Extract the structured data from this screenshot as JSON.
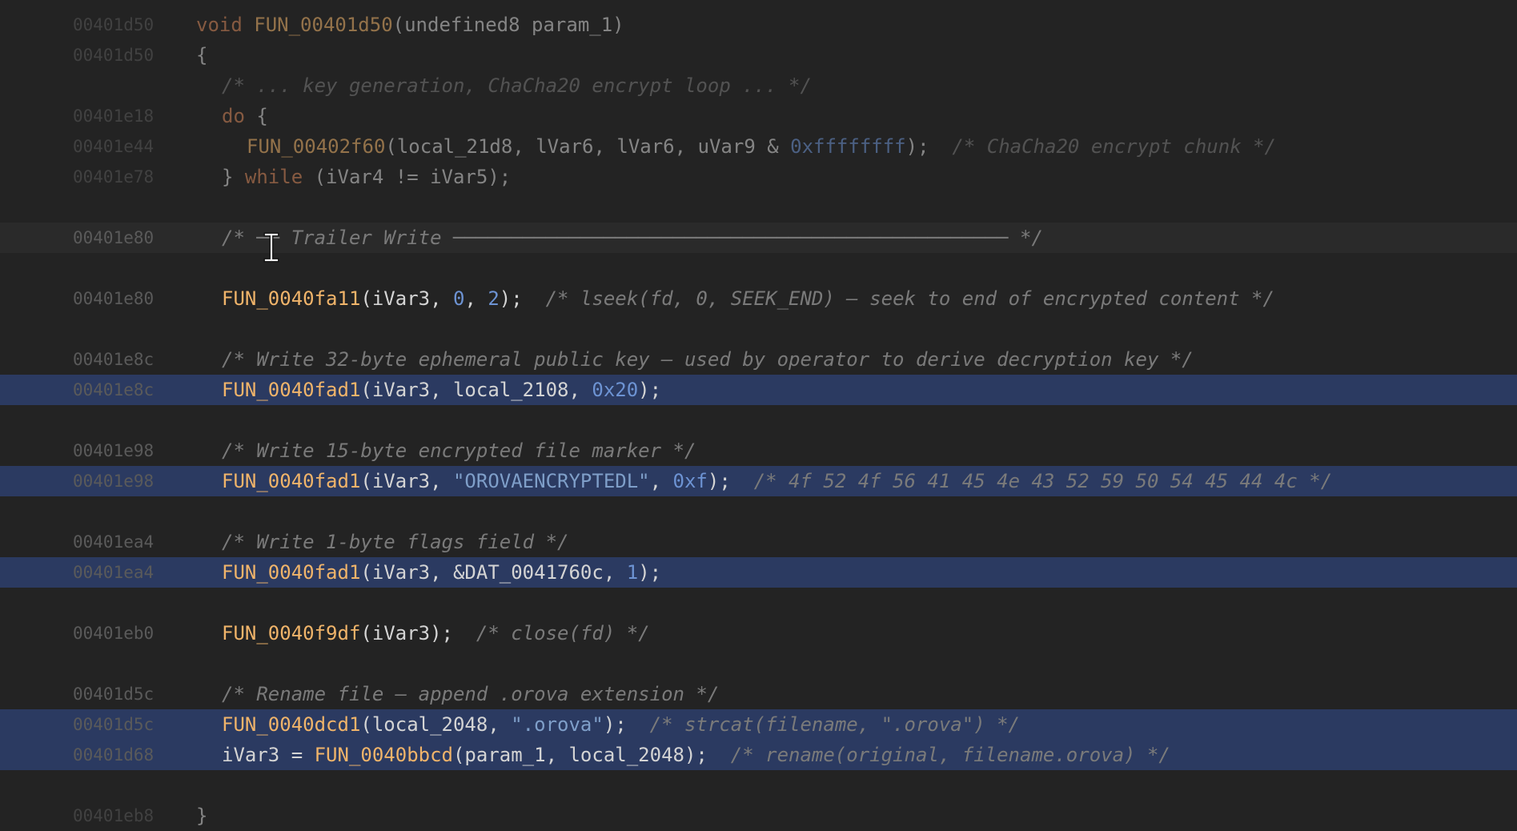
{
  "lines": [
    {
      "address": "00401d50",
      "state": "dim",
      "indent": 245,
      "tokens": [
        {
          "t": "void ",
          "c": "kw"
        },
        {
          "t": "FUN_00401d50",
          "c": "fn"
        },
        {
          "t": "(undefined8 param_1)",
          "c": "tx"
        }
      ]
    },
    {
      "address": "00401d50",
      "state": "dim",
      "indent": 245,
      "tokens": [
        {
          "t": "{",
          "c": "tx"
        }
      ]
    },
    {
      "address": "",
      "state": "dim",
      "indent": 277,
      "tokens": [
        {
          "t": "/* ... key generation, ChaCha20 encrypt loop ... */",
          "c": "cm"
        }
      ]
    },
    {
      "address": "00401e18",
      "state": "dim",
      "indent": 277,
      "tokens": [
        {
          "t": "do",
          "c": "kw"
        },
        {
          "t": " {",
          "c": "tx"
        }
      ]
    },
    {
      "address": "00401e44",
      "state": "dim",
      "indent": 308,
      "tokens": [
        {
          "t": "FUN_00402f60",
          "c": "fn"
        },
        {
          "t": "(local_21d8, lVar6, lVar6, uVar9 & ",
          "c": "tx"
        },
        {
          "t": "0xffffffff",
          "c": "num"
        },
        {
          "t": ");  ",
          "c": "tx"
        },
        {
          "t": "/* ChaCha20 encrypt chunk */",
          "c": "cm"
        }
      ]
    },
    {
      "address": "00401e78",
      "state": "dim",
      "indent": 277,
      "tokens": [
        {
          "t": "} ",
          "c": "tx"
        },
        {
          "t": "while",
          "c": "kw"
        },
        {
          "t": " (iVar4 != iVar5);",
          "c": "tx"
        }
      ]
    },
    {
      "address": "",
      "state": "normal",
      "indent": 277,
      "tokens": []
    },
    {
      "address": "00401e80",
      "state": "current",
      "indent": 277,
      "tokens": [
        {
          "t": "/* ── Trailer Write ──────────────────────────────────────────────── */",
          "c": "cm"
        }
      ]
    },
    {
      "address": "",
      "state": "normal",
      "indent": 277,
      "tokens": []
    },
    {
      "address": "00401e80",
      "state": "normal",
      "indent": 277,
      "tokens": [
        {
          "t": "FUN_0040fa11",
          "c": "fn"
        },
        {
          "t": "(iVar3, ",
          "c": "tx"
        },
        {
          "t": "0",
          "c": "num"
        },
        {
          "t": ", ",
          "c": "tx"
        },
        {
          "t": "2",
          "c": "num"
        },
        {
          "t": ");  ",
          "c": "tx"
        },
        {
          "t": "/* lseek(fd, 0, SEEK_END) — seek to end of encrypted content */",
          "c": "cm"
        }
      ]
    },
    {
      "address": "",
      "state": "normal",
      "indent": 277,
      "tokens": []
    },
    {
      "address": "00401e8c",
      "state": "normal",
      "indent": 277,
      "tokens": [
        {
          "t": "/* Write 32-byte ephemeral public key — used by operator to derive decryption key */",
          "c": "cm"
        }
      ]
    },
    {
      "address": "00401e8c",
      "state": "selected",
      "indent": 277,
      "tokens": [
        {
          "t": "FUN_0040fad1",
          "c": "fn"
        },
        {
          "t": "(iVar3, local_2108, ",
          "c": "tx"
        },
        {
          "t": "0x20",
          "c": "num"
        },
        {
          "t": ");",
          "c": "tx"
        }
      ]
    },
    {
      "address": "",
      "state": "normal",
      "indent": 277,
      "tokens": []
    },
    {
      "address": "00401e98",
      "state": "normal",
      "indent": 277,
      "tokens": [
        {
          "t": "/* Write 15-byte encrypted file marker */",
          "c": "cm"
        }
      ]
    },
    {
      "address": "00401e98",
      "state": "selected",
      "indent": 277,
      "tokens": [
        {
          "t": "FUN_0040fad1",
          "c": "fn"
        },
        {
          "t": "(iVar3, ",
          "c": "tx"
        },
        {
          "t": "\"OROVAENCRYPTEDL\"",
          "c": "str"
        },
        {
          "t": ", ",
          "c": "tx"
        },
        {
          "t": "0xf",
          "c": "num"
        },
        {
          "t": ");  ",
          "c": "tx"
        },
        {
          "t": "/* 4f 52 4f 56 41 45 4e 43 52 59 50 54 45 44 4c */",
          "c": "cm"
        }
      ]
    },
    {
      "address": "",
      "state": "normal",
      "indent": 277,
      "tokens": []
    },
    {
      "address": "00401ea4",
      "state": "normal",
      "indent": 277,
      "tokens": [
        {
          "t": "/* Write 1-byte flags field */",
          "c": "cm"
        }
      ]
    },
    {
      "address": "00401ea4",
      "state": "selected",
      "indent": 277,
      "tokens": [
        {
          "t": "FUN_0040fad1",
          "c": "fn"
        },
        {
          "t": "(iVar3, &DAT_0041760c, ",
          "c": "tx"
        },
        {
          "t": "1",
          "c": "num"
        },
        {
          "t": ");",
          "c": "tx"
        }
      ]
    },
    {
      "address": "",
      "state": "normal",
      "indent": 277,
      "tokens": []
    },
    {
      "address": "00401eb0",
      "state": "normal",
      "indent": 277,
      "tokens": [
        {
          "t": "FUN_0040f9df",
          "c": "fn"
        },
        {
          "t": "(iVar3);  ",
          "c": "tx"
        },
        {
          "t": "/* close(fd) */",
          "c": "cm"
        }
      ]
    },
    {
      "address": "",
      "state": "normal",
      "indent": 277,
      "tokens": []
    },
    {
      "address": "00401d5c",
      "state": "normal",
      "indent": 277,
      "tokens": [
        {
          "t": "/* Rename file — append .orova extension */",
          "c": "cm"
        }
      ]
    },
    {
      "address": "00401d5c",
      "state": "selected",
      "indent": 277,
      "tokens": [
        {
          "t": "FUN_0040dcd1",
          "c": "fn"
        },
        {
          "t": "(local_2048, ",
          "c": "tx"
        },
        {
          "t": "\".orova\"",
          "c": "str"
        },
        {
          "t": ");  ",
          "c": "tx"
        },
        {
          "t": "/* strcat(filename, \".orova\") */",
          "c": "cm"
        }
      ]
    },
    {
      "address": "00401d68",
      "state": "selected",
      "indent": 277,
      "tokens": [
        {
          "t": "iVar3 = ",
          "c": "tx"
        },
        {
          "t": "FUN_0040bbcd",
          "c": "fn"
        },
        {
          "t": "(param_1, local_2048);  ",
          "c": "tx"
        },
        {
          "t": "/* rename(original, filename.orova) */",
          "c": "cm"
        }
      ]
    },
    {
      "address": "",
      "state": "normal",
      "indent": 277,
      "tokens": []
    },
    {
      "address": "00401eb8",
      "state": "dim",
      "indent": 245,
      "tokens": [
        {
          "t": "}",
          "c": "tx"
        }
      ]
    }
  ]
}
